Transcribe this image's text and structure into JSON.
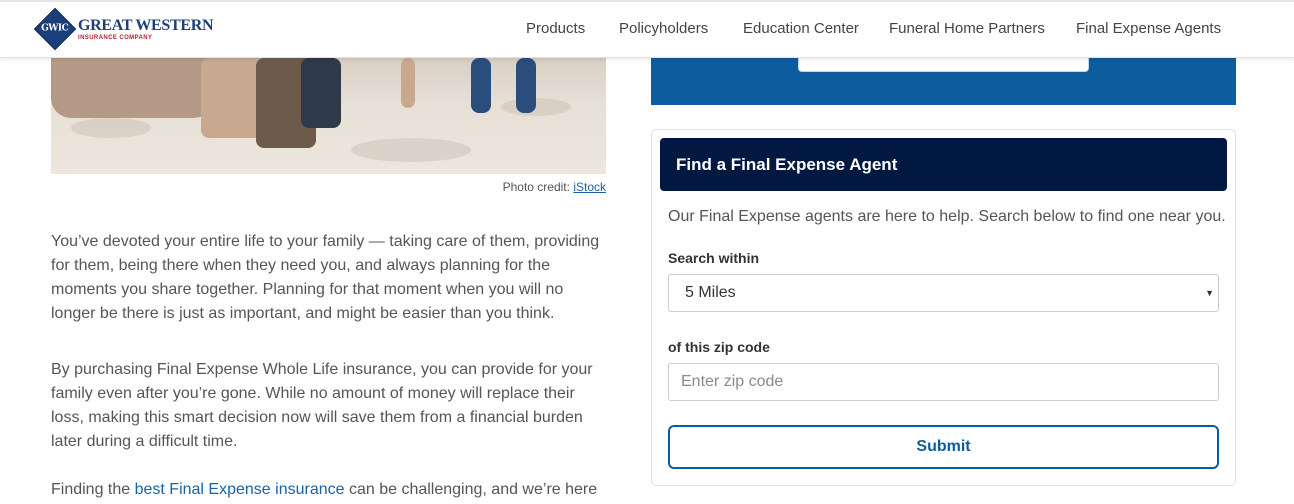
{
  "header": {
    "logo": {
      "mark": "GWIC",
      "name": "GREAT WESTERN",
      "subtitle": "INSURANCE COMPANY"
    },
    "nav": [
      {
        "label": "Products"
      },
      {
        "label": "Policyholders"
      },
      {
        "label": "Education Center"
      },
      {
        "label": "Funeral Home Partners"
      },
      {
        "label": "Final Expense Agents"
      }
    ]
  },
  "article": {
    "photo_credit_prefix": "Photo credit: ",
    "photo_credit_link": "iStock",
    "paragraphs": [
      "You’ve devoted your entire life to your family — taking care of them, providing for them, being there when they need you, and always planning for the moments you share together. Planning for that moment when you will no longer be there is just as important, and might be easier than you think.",
      "By purchasing Final Expense Whole Life insurance, you can provide for your family even after you’re gone. While no amount of money will replace their loss, making this smart decision now will save them from a financial burden later during a difficult time."
    ],
    "partial_paragraph": {
      "before": "Finding the ",
      "link": "best Final Expense insurance",
      "after": " can be challenging, and we’re here to"
    }
  },
  "agent_finder": {
    "title": "Find a Final Expense Agent",
    "description": "Our Final Expense agents are here to help. Search below to find one near you.",
    "search_within_label": "Search within",
    "search_within_value": "5 Miles",
    "zip_label": "of this zip code",
    "zip_placeholder": "Enter zip code",
    "submit_label": "Submit"
  },
  "colors": {
    "brand_navy": "#011940",
    "brand_blue": "#0d5c9e",
    "link_blue": "#1a63a5"
  }
}
